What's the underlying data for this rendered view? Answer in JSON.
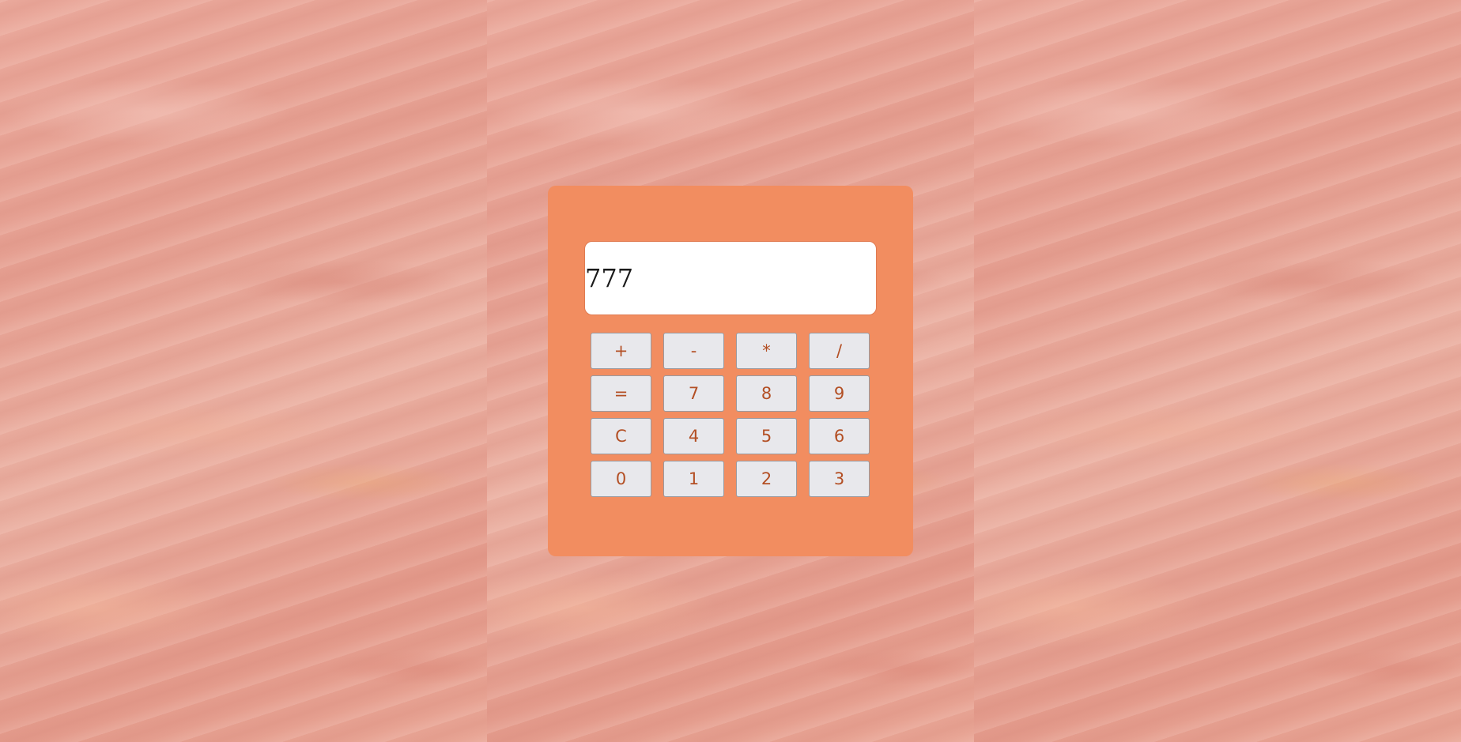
{
  "calculator": {
    "display_value": "777",
    "keys": [
      {
        "label": "+",
        "name": "key-plus"
      },
      {
        "label": "-",
        "name": "key-minus"
      },
      {
        "label": "*",
        "name": "key-multiply"
      },
      {
        "label": "/",
        "name": "key-divide"
      },
      {
        "label": "=",
        "name": "key-equals"
      },
      {
        "label": "7",
        "name": "key-7"
      },
      {
        "label": "8",
        "name": "key-8"
      },
      {
        "label": "9",
        "name": "key-9"
      },
      {
        "label": "C",
        "name": "key-clear"
      },
      {
        "label": "4",
        "name": "key-4"
      },
      {
        "label": "5",
        "name": "key-5"
      },
      {
        "label": "6",
        "name": "key-6"
      },
      {
        "label": "0",
        "name": "key-0"
      },
      {
        "label": "1",
        "name": "key-1"
      },
      {
        "label": "2",
        "name": "key-2"
      },
      {
        "label": "3",
        "name": "key-3"
      }
    ]
  },
  "colors": {
    "calculator_body": "#f28d60",
    "key_text": "#b34f24",
    "key_background": "#e8e8ec",
    "display_background": "#ffffff"
  }
}
